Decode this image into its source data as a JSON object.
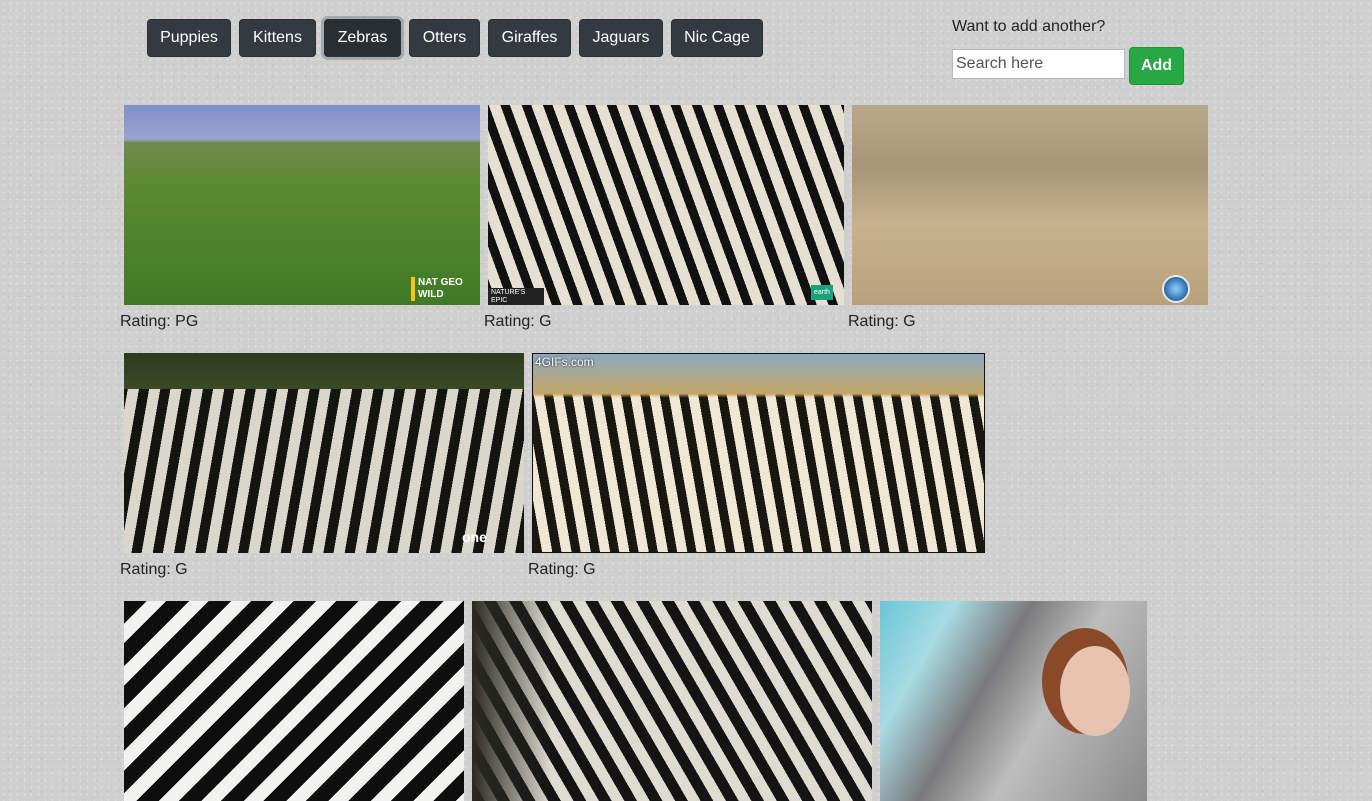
{
  "nav": {
    "buttons": [
      {
        "label": "Puppies"
      },
      {
        "label": "Kittens"
      },
      {
        "label": "Zebras",
        "active": true
      },
      {
        "label": "Otters"
      },
      {
        "label": "Giraffes"
      },
      {
        "label": "Jaguars"
      },
      {
        "label": "Nic Cage"
      }
    ]
  },
  "add_panel": {
    "prompt": "Want to add another?",
    "placeholder": "Search here",
    "button_label": "Add"
  },
  "gifs": [
    {
      "rating": "Rating: PG",
      "watermark": "NAT GEO WILD"
    },
    {
      "rating": "Rating: G",
      "watermark": "NATURE'S EPIC JOURNEYS",
      "watermark2": "earth"
    },
    {
      "rating": "Rating: G",
      "watermark": ""
    },
    {
      "rating": "Rating: G",
      "watermark": "one"
    },
    {
      "rating": "Rating: G",
      "watermark": "4GIFs.com"
    },
    {
      "rating": "",
      "watermark": ""
    },
    {
      "rating": "",
      "watermark": ""
    },
    {
      "rating": "",
      "watermark": ""
    }
  ],
  "colors": {
    "nav_button": "#343a40",
    "add_button": "#28a745",
    "background": "#cfcfcf"
  }
}
